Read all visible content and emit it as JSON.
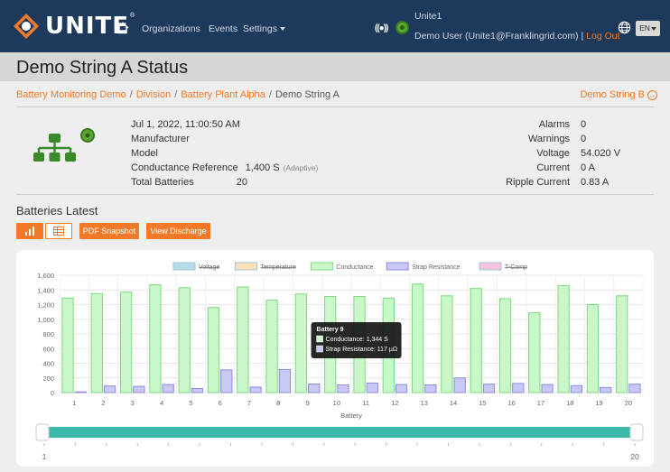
{
  "nav": {
    "logo_text": "UNITE",
    "logo_tm": "®",
    "links": [
      "Organizations",
      "Events",
      "Settings"
    ],
    "connection_icon": "((●))",
    "user_org": "Unite1",
    "user_line": "Demo User (Unite1@Franklingrid.com) | ",
    "logout": "Log Out",
    "language": "EN"
  },
  "page": {
    "title": "Demo String A Status"
  },
  "breadcrumb": {
    "items": [
      "Battery Monitoring Demo",
      "Division",
      "Battery Plant Alpha"
    ],
    "current": "Demo String A",
    "next": "Demo String B"
  },
  "info": {
    "datetime": "Jul 1, 2022, 11:00:50 AM",
    "manufacturer_label": "Manufacturer",
    "model_label": "Model",
    "conductance_ref_label": "Conductance Reference",
    "conductance_ref_value": "1,400 S",
    "adaptive": "(Adaptive)",
    "total_batteries_label": "Total Batteries",
    "total_batteries_value": "20",
    "alarms_label": "Alarms",
    "alarms_value": "0",
    "warnings_label": "Warnings",
    "warnings_value": "0",
    "voltage_label": "Voltage",
    "voltage_value": "54.020 V",
    "current_label": "Current",
    "current_value": "0 A",
    "ripple_label": "Ripple Current",
    "ripple_value": "0.83 A"
  },
  "batteries": {
    "title": "Batteries Latest",
    "pdf_button": "PDF Snapshot",
    "discharge_button": "View Discharge"
  },
  "slider": {
    "min_label": "1",
    "max_label": "20"
  },
  "colors": {
    "accent": "#f07a2a",
    "nav_bg": "#1d3a5c",
    "conductance_fill": "#c9f7c9",
    "conductance_stroke": "#7fd87f",
    "strap_fill": "#c8c8f5",
    "strap_stroke": "#8c8ce0",
    "slider": "#3bb8a8"
  },
  "chart_data": {
    "type": "bar",
    "xlabel": "Battery",
    "ylim": [
      0,
      1600
    ],
    "yticks": [
      "0",
      "200",
      "400",
      "600",
      "800",
      "1,000",
      "1,200",
      "1,400",
      "1,600"
    ],
    "categories": [
      "1",
      "2",
      "3",
      "4",
      "5",
      "6",
      "7",
      "8",
      "9",
      "10",
      "11",
      "12",
      "13",
      "14",
      "15",
      "16",
      "17",
      "18",
      "19",
      "20"
    ],
    "legend": [
      {
        "name": "Voltage",
        "hidden": true,
        "color": "#b9dde8"
      },
      {
        "name": "Temperature",
        "hidden": true,
        "color": "#fde1b8"
      },
      {
        "name": "Conductance",
        "hidden": false,
        "color": "#c9f7c9"
      },
      {
        "name": "Strap Resistance",
        "hidden": false,
        "color": "#c8c8f5"
      },
      {
        "name": "T-Comp",
        "hidden": true,
        "color": "#f9c4de"
      }
    ],
    "series": [
      {
        "name": "Conductance",
        "values": [
          1290,
          1350,
          1370,
          1470,
          1430,
          1160,
          1440,
          1260,
          1344,
          1310,
          1310,
          1290,
          1480,
          1320,
          1420,
          1280,
          1090,
          1460,
          1200,
          1320
        ]
      },
      {
        "name": "Strap Resistance",
        "values": [
          10,
          90,
          85,
          110,
          55,
          310,
          75,
          315,
          117,
          105,
          130,
          110,
          105,
          200,
          115,
          125,
          110,
          95,
          70,
          115
        ]
      }
    ],
    "tooltip": {
      "title": "Battery 9",
      "lines": [
        "Conductance: 1,344 S",
        "Strap Resistance: 117 µΩ"
      ]
    }
  }
}
